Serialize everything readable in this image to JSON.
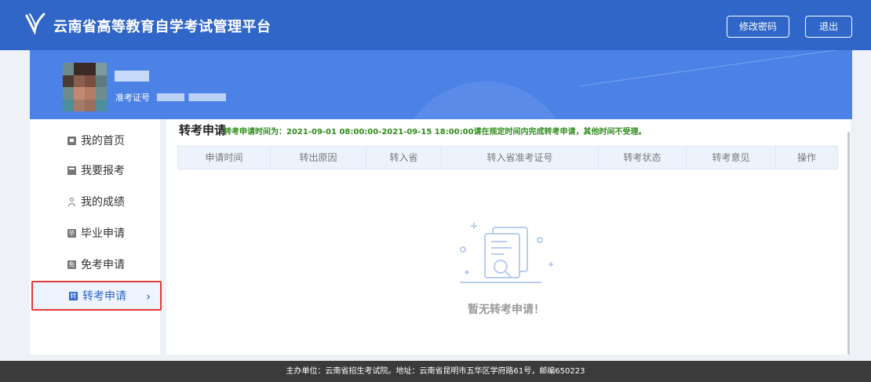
{
  "header": {
    "app_title": "云南省高等教育自学考试管理平台",
    "change_password_label": "修改密码",
    "logout_label": "退出",
    "brand_color": "#2f66c8"
  },
  "profile": {
    "exam_no_label": "准考证号"
  },
  "sidebar": {
    "items": [
      {
        "label": "我的首页",
        "icon": "home-icon"
      },
      {
        "label": "我要报考",
        "icon": "register-icon"
      },
      {
        "label": "我的成绩",
        "icon": "user-score-icon"
      },
      {
        "label": "毕业申请",
        "icon": "graduation-icon",
        "glyph": "毕"
      },
      {
        "label": "免考申请",
        "icon": "exemption-icon",
        "glyph": "免"
      },
      {
        "label": "转考申请",
        "icon": "transfer-icon",
        "glyph": "转",
        "active": true
      }
    ],
    "chevron": "›"
  },
  "main": {
    "page_title": "转考申请",
    "notice": "转考申请时间为：2021-09-01 08:00:00-2021-09-15 18:00:00请在规定时间内完成转考申请，其他时间不受理。",
    "table": {
      "columns": [
        "申请时间",
        "转出原因",
        "转入省",
        "转入省准考证号",
        "转考状态",
        "转考意见",
        "操作"
      ]
    },
    "empty_text": "暂无转考申请！"
  },
  "footer": {
    "text": "主办单位：云南省招生考试院。地址：云南省昆明市五华区学府路61号，邮编650223"
  }
}
